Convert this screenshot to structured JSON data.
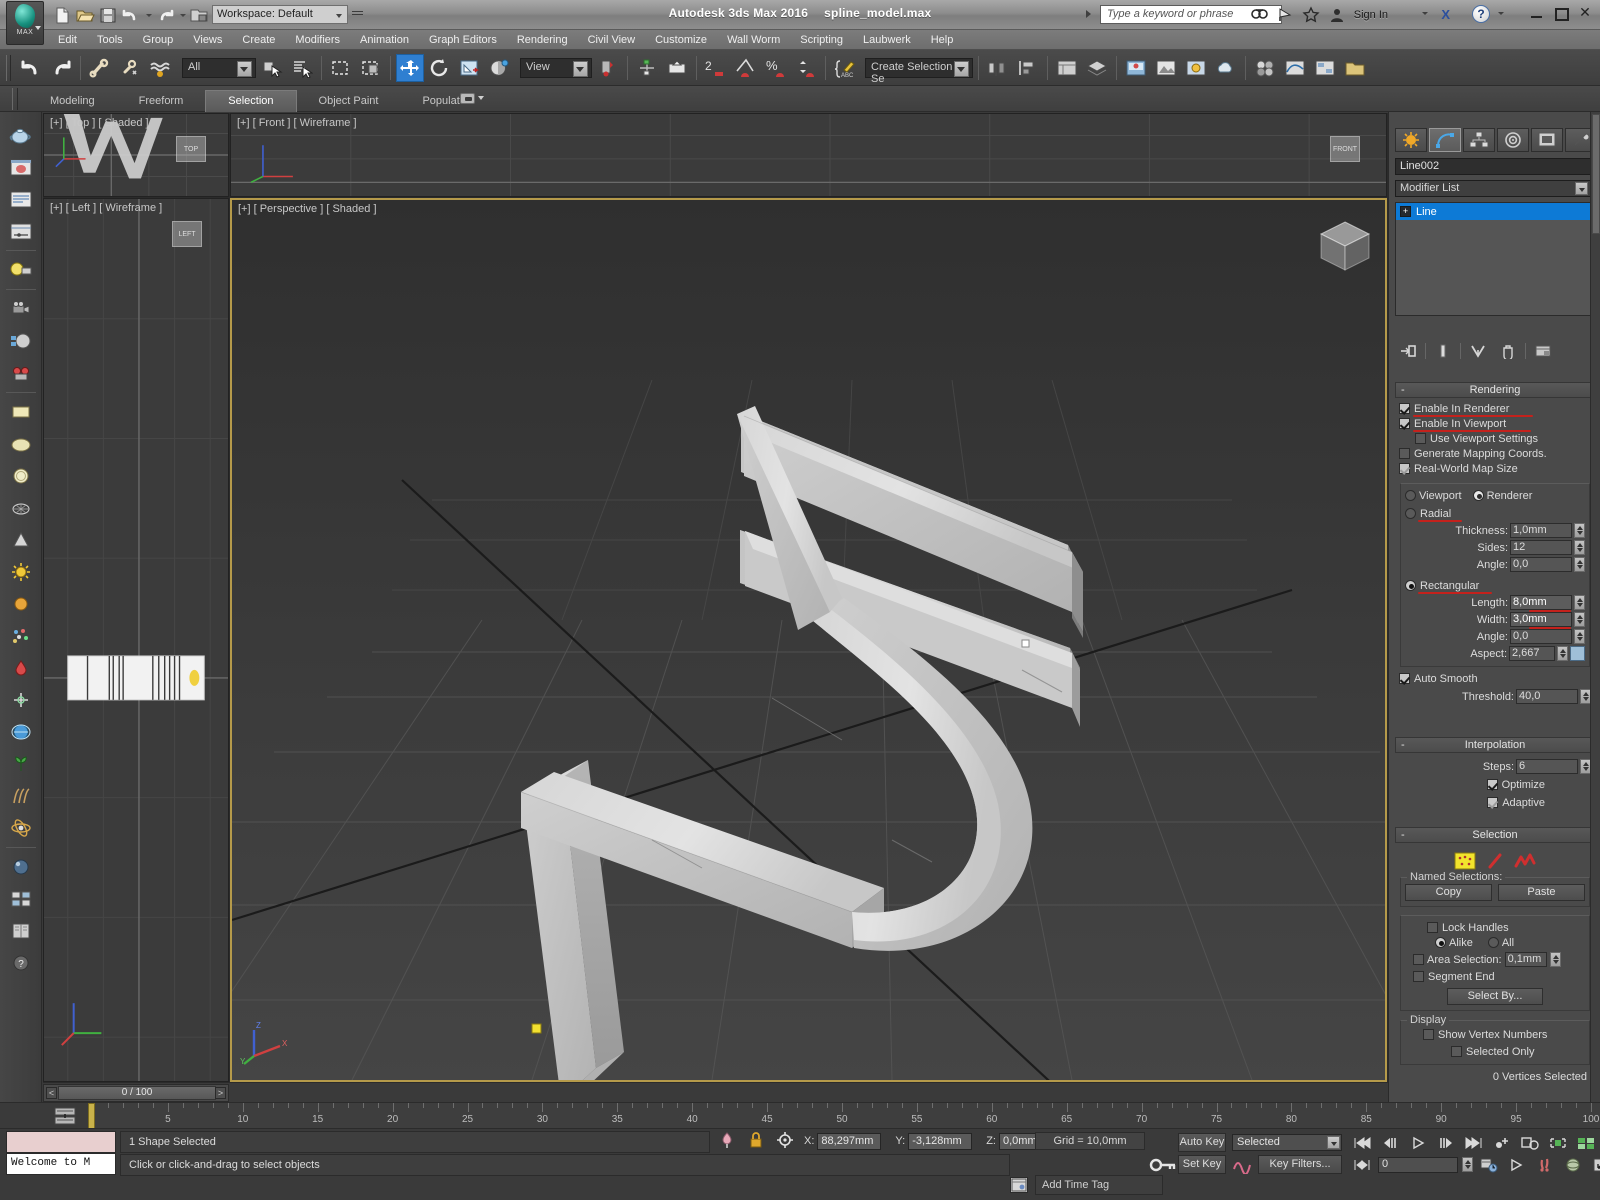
{
  "app": {
    "title": "Autodesk 3ds Max 2016",
    "filename": "spline_model.max",
    "workspace_label": "Workspace: Default",
    "search_placeholder": "Type a keyword or phrase",
    "sign_in": "Sign In",
    "help_glyph": "?"
  },
  "menu": {
    "items": [
      "Edit",
      "Tools",
      "Group",
      "Views",
      "Create",
      "Modifiers",
      "Animation",
      "Graph Editors",
      "Rendering",
      "Civil View",
      "Customize",
      "Wall Worm",
      "Scripting",
      "Laubwerk",
      "Help"
    ]
  },
  "toolbar": {
    "selection_filter": "All",
    "reference_coord": "View",
    "named_selection_sets": "Create Selection Se",
    "icons": [
      "undo-icon",
      "redo-icon",
      "select-link-icon",
      "unlink-icon",
      "bind-spacewarp-icon",
      "select-object-icon",
      "select-by-name-icon",
      "rectangular-region-icon",
      "window-crossing-icon",
      "select-and-move-icon",
      "select-and-rotate-icon",
      "select-and-scale-icon",
      "placement-icon",
      "mirror-icon",
      "align-icon",
      "snap-toggle-icon",
      "angle-snap-icon",
      "percent-snap-icon",
      "spinner-snap-icon",
      "named-selection-sets-icon",
      "curve-editor-icon",
      "schematic-view-icon",
      "material-editor-icon",
      "render-setup-icon",
      "rendered-frame-icon",
      "render-production-icon",
      "layer-manager-icon",
      "ribbon-toggle-icon",
      "project-folder-icon",
      "scene-explorer-icon"
    ]
  },
  "ribbon": {
    "tabs": [
      "Modeling",
      "Freeform",
      "Selection",
      "Object Paint",
      "Populate"
    ],
    "active_tab": "Selection"
  },
  "left_toolbar": {
    "icons": [
      "teapot-icon",
      "render-preview-icon",
      "properties-icon",
      "curve-editor-icon",
      "light-icon",
      "camera-icon",
      "material-icon",
      "colorpicker-icon",
      "plane-icon",
      "sphere-squash-icon",
      "circle-icon",
      "teapot-wire-icon",
      "cone-icon",
      "sun-icon",
      "sphere-orange-icon",
      "particles-icon",
      "paint-drop-icon",
      "helper-icon",
      "globe-icon",
      "foliage-icon",
      "hair-icon",
      "atom-icon",
      "sphere-blue-icon",
      "grid-layout-icon",
      "book-icon",
      "question-icon"
    ]
  },
  "viewports": [
    {
      "label": "[+] [ Top ] [ Shaded ]",
      "name": "viewport-top"
    },
    {
      "label": "[+] [ Front ] [ Wireframe ]",
      "name": "viewport-front"
    },
    {
      "label": "[+] [ Left ] [ Wireframe ]",
      "name": "viewport-left"
    },
    {
      "label": "[+] [ Perspective ] [ Shaded ]",
      "name": "viewport-perspective"
    }
  ],
  "viewcube": {
    "top_label": "TOP",
    "front_label": "FRONT",
    "left_label": "LEFT"
  },
  "command_panel": {
    "tabs": [
      "create-tab",
      "modify-tab",
      "hierarchy-tab",
      "motion-tab",
      "display-tab",
      "utilities-tab"
    ],
    "active_tab_index": 1,
    "object_name": "Line002",
    "modifier_list_label": "Modifier List",
    "stack": [
      {
        "label": "Line",
        "selected": true
      }
    ],
    "stack_buttons": [
      "pin-stack-icon",
      "show-end-result-icon",
      "make-unique-icon",
      "remove-modifier-icon",
      "configure-sets-icon"
    ],
    "rendering": {
      "title": "Rendering",
      "enable_in_renderer": {
        "label": "Enable In Renderer",
        "checked": true
      },
      "enable_in_viewport": {
        "label": "Enable In Viewport",
        "checked": true
      },
      "use_viewport_settings": {
        "label": "Use Viewport Settings",
        "checked": false
      },
      "generate_mapping_coords": {
        "label": "Generate Mapping Coords.",
        "checked": false
      },
      "real_world_map_size": {
        "label": "Real-World Map Size",
        "checked": true
      },
      "viewport_radio": {
        "label": "Viewport",
        "selected": false
      },
      "renderer_radio": {
        "label": "Renderer",
        "selected": true
      },
      "radial": {
        "label": "Radial",
        "selected": false
      },
      "thickness": {
        "label": "Thickness:",
        "value": "1,0mm"
      },
      "sides": {
        "label": "Sides:",
        "value": "12"
      },
      "radial_angle": {
        "label": "Angle:",
        "value": "0,0"
      },
      "rectangular": {
        "label": "Rectangular",
        "selected": true
      },
      "length": {
        "label": "Length:",
        "value": "8,0mm"
      },
      "width": {
        "label": "Width:",
        "value": "3,0mm"
      },
      "rect_angle": {
        "label": "Angle:",
        "value": "0,0"
      },
      "aspect": {
        "label": "Aspect:",
        "value": "2,667"
      },
      "auto_smooth": {
        "label": "Auto Smooth",
        "checked": true
      },
      "threshold": {
        "label": "Threshold:",
        "value": "40,0"
      }
    },
    "interpolation": {
      "title": "Interpolation",
      "steps": {
        "label": "Steps:",
        "value": "6"
      },
      "optimize": {
        "label": "Optimize",
        "checked": true
      },
      "adaptive": {
        "label": "Adaptive",
        "checked": true
      }
    },
    "selection": {
      "title": "Selection",
      "sub_object_levels": [
        "vertex-level-icon",
        "segment-level-icon",
        "spline-level-icon"
      ],
      "active_level": "vertex-level-icon",
      "named_selections_label": "Named Selections:",
      "copy_label": "Copy",
      "paste_label": "Paste",
      "lock_handles": {
        "label": "Lock Handles",
        "checked": false
      },
      "alike": {
        "label": "Alike",
        "selected": true
      },
      "all": {
        "label": "All",
        "selected": false
      },
      "area_selection": {
        "label": "Area Selection:",
        "checked": false,
        "value": "0,1mm"
      },
      "segment_end": {
        "label": "Segment End",
        "checked": false
      },
      "select_by": "Select By...",
      "display_label": "Display",
      "show_vertex_numbers": {
        "label": "Show Vertex Numbers",
        "checked": false
      },
      "selected_only": {
        "label": "Selected Only",
        "checked": false
      },
      "status": "0 Vertices Selected"
    }
  },
  "timeline": {
    "slider_label": "0 / 100",
    "prev_arrow": "<",
    "next_arrow": ">",
    "ruler_ticks": [
      5,
      10,
      15,
      20,
      25,
      30,
      35,
      40,
      45,
      50,
      55,
      60,
      65,
      70,
      75,
      80,
      85,
      90,
      95,
      100
    ]
  },
  "status_bar": {
    "maxscript_prompt": "Welcome to M",
    "selection_status": "1 Shape Selected",
    "hint": "Click or click-and-drag to select objects",
    "coords": {
      "x_label": "X:",
      "x_value": "88,297mm",
      "y_label": "Y:",
      "y_value": "-3,128mm",
      "z_label": "Z:",
      "z_value": "0,0mm"
    },
    "grid": "Grid = 10,0mm",
    "auto_key": "Auto Key",
    "set_key": "Set Key",
    "key_mode": "Selected",
    "key_filters": "Key Filters...",
    "frame_value": "0",
    "add_time_tag": "Add Time Tag",
    "icons": [
      "absolute-relative-icon",
      "lock-selection-icon",
      "transform-center-icon",
      "key-toggle-icon",
      "goto-start-icon",
      "prev-frame-icon",
      "play-icon",
      "next-frame-icon",
      "goto-end-icon",
      "key-mode-icon",
      "time-config-icon",
      "zoom-extents-icon",
      "pan-icon",
      "orbit-icon",
      "maximize-viewport-icon"
    ]
  },
  "colors": {
    "accent_blue": "#0d7ad6",
    "active_viewport_border": "#b59a4a",
    "annotation_red": "#c4211c",
    "selected_highlight": "#2f7fd1"
  }
}
